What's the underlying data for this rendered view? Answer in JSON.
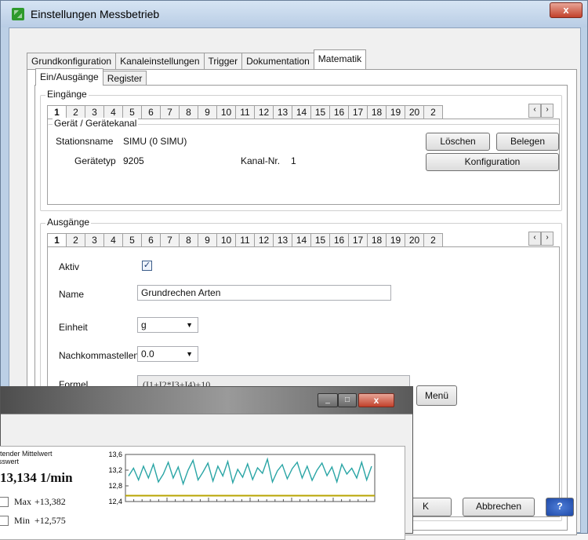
{
  "window": {
    "title": "Einstellungen Messbetrieb",
    "close_label": "x"
  },
  "main_tabs": [
    "Grundkonfiguration",
    "Kanaleinstellungen",
    "Trigger",
    "Dokumentation",
    "Matematik"
  ],
  "sub_tabs": [
    "Ein/Ausgänge",
    "Register"
  ],
  "eingaenge": {
    "title": "Eingänge",
    "channels": [
      "1",
      "2",
      "3",
      "4",
      "5",
      "6",
      "7",
      "8",
      "9",
      "10",
      "11",
      "12",
      "13",
      "14",
      "15",
      "16",
      "17",
      "18",
      "19",
      "20",
      "2"
    ],
    "scroll_left": "‹",
    "scroll_right": "›",
    "group_title": "Gerät / Gerätekanal",
    "stationsname_label": "Stationsname",
    "stationsname_value": "SIMU (0 SIMU)",
    "geraetetyp_label": "Gerätetyp",
    "geraetetyp_value": "9205",
    "kanalnr_label": "Kanal-Nr.",
    "kanalnr_value": "1",
    "loeschen_label": "Löschen",
    "belegen_label": "Belegen",
    "konfiguration_label": "Konfiguration"
  },
  "ausgaenge": {
    "title": "Ausgänge",
    "channels": [
      "1",
      "2",
      "3",
      "4",
      "5",
      "6",
      "7",
      "8",
      "9",
      "10",
      "11",
      "12",
      "13",
      "14",
      "15",
      "16",
      "17",
      "18",
      "19",
      "20",
      "2"
    ],
    "aktiv_label": "Aktiv",
    "aktiv_checked": true,
    "name_label": "Name",
    "name_value": "Grundrechen Arten",
    "einheit_label": "Einheit",
    "einheit_value": "g",
    "nachkomma_label": "Nachkommastellen",
    "nachkomma_value": "0.0",
    "formel_label": "Formel",
    "formel_value": "(I1+I2*I3+I4)+10",
    "menu_label": "Menü"
  },
  "footer": {
    "ok_label": "K",
    "abbrechen_label": "Abbrechen",
    "help_label": "?"
  },
  "chart_window": {
    "minimize": "_",
    "maximize": "□",
    "close": "x",
    "desc_line1": "itender Mittelwert",
    "desc_line2": "sswert",
    "big_value": "13,134 1/min",
    "max_label": "Max",
    "max_value": "+13,382",
    "min_label": "Min",
    "min_value": "+12,575"
  },
  "chart_data": {
    "type": "line",
    "y_ticks": [
      "13,6",
      "13,2",
      "12,8",
      "12,4"
    ],
    "ylim": [
      12.4,
      13.6
    ],
    "grid": false,
    "series": [
      {
        "color": "#2aa5a5",
        "values": [
          13.05,
          13.25,
          12.95,
          13.3,
          13.0,
          13.35,
          12.9,
          13.1,
          13.4,
          13.0,
          13.28,
          12.85,
          13.2,
          13.45,
          12.95,
          13.15,
          13.38,
          12.92,
          13.3,
          13.05,
          13.42,
          12.88,
          13.22,
          13.02,
          13.36,
          12.96,
          13.26,
          13.12,
          13.48,
          12.9,
          13.18,
          13.34,
          12.98,
          13.24,
          13.4,
          13.0,
          13.3,
          12.94,
          13.2,
          13.38,
          13.06,
          13.28,
          12.9,
          13.35,
          13.1,
          13.25,
          13.0,
          13.4,
          12.95,
          13.3
        ]
      }
    ],
    "baseline": {
      "color": "#b8a400",
      "value": 12.55
    }
  }
}
